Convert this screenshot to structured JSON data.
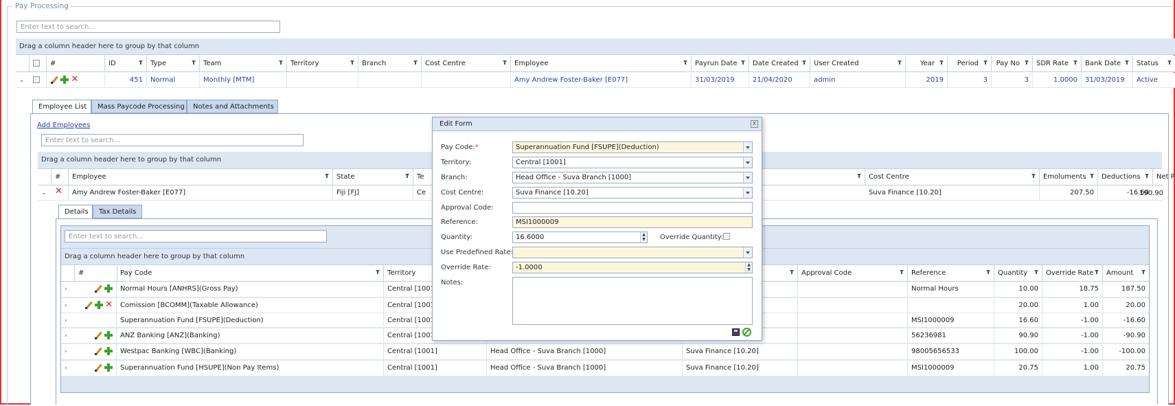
{
  "page": {
    "legend": "Pay Processing"
  },
  "top_grid": {
    "search_placeholder": "Enter text to search...",
    "group_hint": "Drag a column header here to group by that column",
    "columns": [
      "#",
      "ID",
      "Type",
      "Team",
      "Territory",
      "Branch",
      "Cost Centre",
      "Employee",
      "Payrun Date",
      "Date Created",
      "User Created",
      "Year",
      "Period",
      "Pay No",
      "SDR Rate",
      "Bank Date",
      "Status"
    ],
    "row": {
      "id": "451",
      "type": "Normal",
      "team": "Monthly [MTM]",
      "territory": "",
      "branch": "",
      "cost_centre": "",
      "employee": "Amy Andrew Foster-Baker [E077]",
      "payrun_date": "31/03/2019",
      "date_created": "21/04/2020",
      "user_created": "admin",
      "year": "2019",
      "period": "3",
      "pay_no": "3",
      "sdr_rate": "1.0000",
      "bank_date": "31/03/2019",
      "status": "Active"
    }
  },
  "tabs": [
    "Employee List",
    "Mass Paycode Processing",
    "Notes and Attachments"
  ],
  "employee_list": {
    "add_link": "Add Employees",
    "search_placeholder": "Enter text to search...",
    "group_hint": "Drag a column header here to group by that column",
    "columns": [
      "#",
      "Employee",
      "State",
      "Te",
      "",
      "Cost Centre",
      "Emoluments",
      "Deductions",
      "Net Pay"
    ],
    "row": {
      "employee": "Amy Andrew Foster-Baker [E077]",
      "state": "Fiji [FJ]",
      "te": "Ce",
      "cost_centre": "Suva Finance [10.20]",
      "emoluments": "207.50",
      "deductions": "-16.60",
      "net_pay": "190.90"
    }
  },
  "sub_tabs": [
    "Details",
    "Tax Details"
  ],
  "details": {
    "search_placeholder": "Enter text to search...",
    "group_hint": "Drag a column header here to group by that column",
    "columns": [
      "#",
      "Pay Code",
      "Territory",
      "",
      "",
      "Approval Code",
      "Reference",
      "Quantity",
      "Override Rate",
      "Amount"
    ],
    "rows": [
      {
        "pay_code": "Normal Hours [ANHRS](Gross Pay)",
        "territory": "Central [1001",
        "branch": "",
        "cost_centre": "",
        "reference": "Normal Hours",
        "quantity": "10.00",
        "rate": "18.75",
        "amount": "187.50",
        "icons": "edit-add"
      },
      {
        "pay_code": "Comission [BCOMM](Taxable Allowance)",
        "territory": "Central [1001",
        "branch": "",
        "cost_centre": "",
        "reference": "",
        "quantity": "20.00",
        "rate": "1.00",
        "amount": "20.00",
        "icons": "edit-add-delete"
      },
      {
        "pay_code": "Superannuation Fund [FSUPE](Deduction)",
        "territory": "Central [1001",
        "branch": "",
        "cost_centre": "",
        "reference": "MSI1000009",
        "quantity": "16.60",
        "rate": "-1.00",
        "amount": "-16.60",
        "icons": "none"
      },
      {
        "pay_code": "ANZ Banking [ANZ](Banking)",
        "territory": "Central [1001",
        "branch": "",
        "cost_centre": "",
        "reference": "56236981",
        "quantity": "90.90",
        "rate": "-1.00",
        "amount": "-90.90",
        "icons": "edit-add"
      },
      {
        "pay_code": "Westpac Banking [WBC](Banking)",
        "territory": "Central [1001]",
        "branch": "Head Office - Suva Branch [1000]",
        "cost_centre": "Suva Finance [10.20]",
        "reference": "98005656533",
        "quantity": "100.00",
        "rate": "-1.00",
        "amount": "-100.00",
        "icons": "edit-add"
      },
      {
        "pay_code": "Superannuation Fund [HSUPE](Non Pay Items)",
        "territory": "Central [1001]",
        "branch": "Head Office - Suva Branch [1000]",
        "cost_centre": "Suva Finance [10.20]",
        "reference": "MSI1000009",
        "quantity": "20.75",
        "rate": "1.00",
        "amount": "20.75",
        "icons": "edit-add"
      }
    ]
  },
  "edit_form": {
    "title": "Edit Form",
    "close": "x",
    "labels": {
      "pay_code": "Pay Code:",
      "required": "*",
      "territory": "Territory:",
      "branch": "Branch:",
      "cost_centre": "Cost Centre:",
      "approval_code": "Approval Code:",
      "reference": "Reference:",
      "quantity": "Quantity:",
      "override_quantity": "Override Quantity:",
      "use_predefined_rate": "Use Predefined Rate:",
      "override_rate": "Override Rate:",
      "notes": "Notes:"
    },
    "values": {
      "pay_code": "Superannuation Fund [FSUPE](Deduction)",
      "territory": "Central [1001]",
      "branch": "Head Office - Suva Branch [1000]",
      "cost_centre": "Suva Finance [10.20]",
      "approval_code": "",
      "reference": "MSI1000009",
      "quantity": "16.6000",
      "use_predefined_rate": "",
      "override_rate": "-1.0000",
      "notes": ""
    }
  }
}
